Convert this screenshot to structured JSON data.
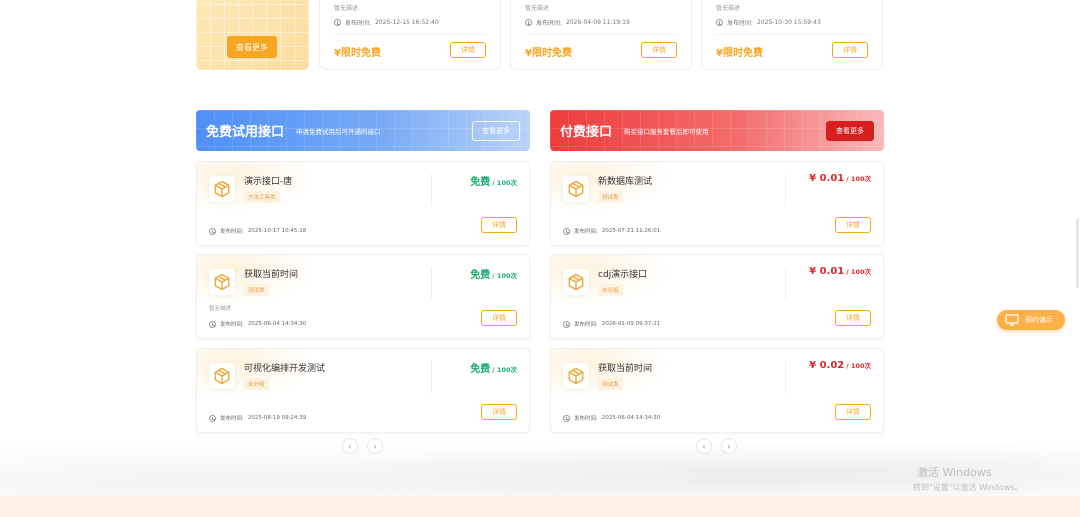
{
  "top_section": {
    "view_more_label": "查看更多",
    "cards": [
      {
        "desc": "暂无描述",
        "time_label": "发布时间:",
        "time": "2025-12-15 16:52:40",
        "price": "¥限时免费",
        "detail_label": "详情"
      },
      {
        "desc": "暂无描述",
        "time_label": "发布时间:",
        "time": "2026-04-09 11:19:19",
        "price": "¥限时免费",
        "detail_label": "详情"
      },
      {
        "desc": "暂无描述",
        "time_label": "发布时间:",
        "time": "2025-10-30 15:59:43",
        "price": "¥限时免费",
        "detail_label": "详情"
      }
    ]
  },
  "free_section": {
    "title": "免费试用接口",
    "subtitle": "申请免费试用后可开通的接口",
    "more_label": "查看更多",
    "items": [
      {
        "name": "演示接口-唐",
        "tag": "方法工具类",
        "desc": "",
        "time_label": "发布时间:",
        "time": "2025-10-17 10:45:18",
        "price": "免费",
        "unit": "/ 100次",
        "detail_label": "详情"
      },
      {
        "name": "获取当前时间",
        "tag": "测试类",
        "desc": "暂无描述",
        "time_label": "发布时间:",
        "time": "2025-06-04 14:34:30",
        "price": "免费",
        "unit": "/ 100次",
        "detail_label": "详情"
      },
      {
        "name": "可视化编排开发测试",
        "tag": "未分组",
        "desc": "",
        "time_label": "发布时间:",
        "time": "2025-08-19 09:24:39",
        "price": "免费",
        "unit": "/ 100次",
        "detail_label": "详情"
      }
    ]
  },
  "paid_section": {
    "title": "付费接口",
    "subtitle": "购买接口服务套餐后即可使用",
    "more_label": "查看更多",
    "items": [
      {
        "name": "新数据库测试",
        "tag": "测试类",
        "desc": "",
        "time_label": "发布时间:",
        "time": "2025-07-21 11:26:01",
        "price": "¥ 0.01",
        "unit": "/ 100次",
        "detail_label": "详情"
      },
      {
        "name": "cdj演示接口",
        "tag": "未分组",
        "desc": "",
        "time_label": "发布时间:",
        "time": "2026-01-09 09:37:21",
        "price": "¥ 0.01",
        "unit": "/ 100次",
        "detail_label": "详情"
      },
      {
        "name": "获取当前时间",
        "tag": "测试类",
        "desc": "",
        "time_label": "发布时间:",
        "time": "2025-06-04 14:34:30",
        "price": "¥ 0.02",
        "unit": "/ 100次",
        "detail_label": "详情"
      }
    ]
  },
  "pager": {
    "prev": "‹",
    "next": "›"
  },
  "float_button": {
    "label": "预约演示"
  },
  "watermark": {
    "line1": "激活 Windows",
    "line2": "转到\"设置\"以激活 Windows。"
  },
  "colors": {
    "accent_orange": "#f6a623",
    "free_green": "#1aab6e",
    "paid_red": "#e0282b",
    "banner_blue": "#4e8ef7",
    "banner_red": "#ee3b3b"
  }
}
